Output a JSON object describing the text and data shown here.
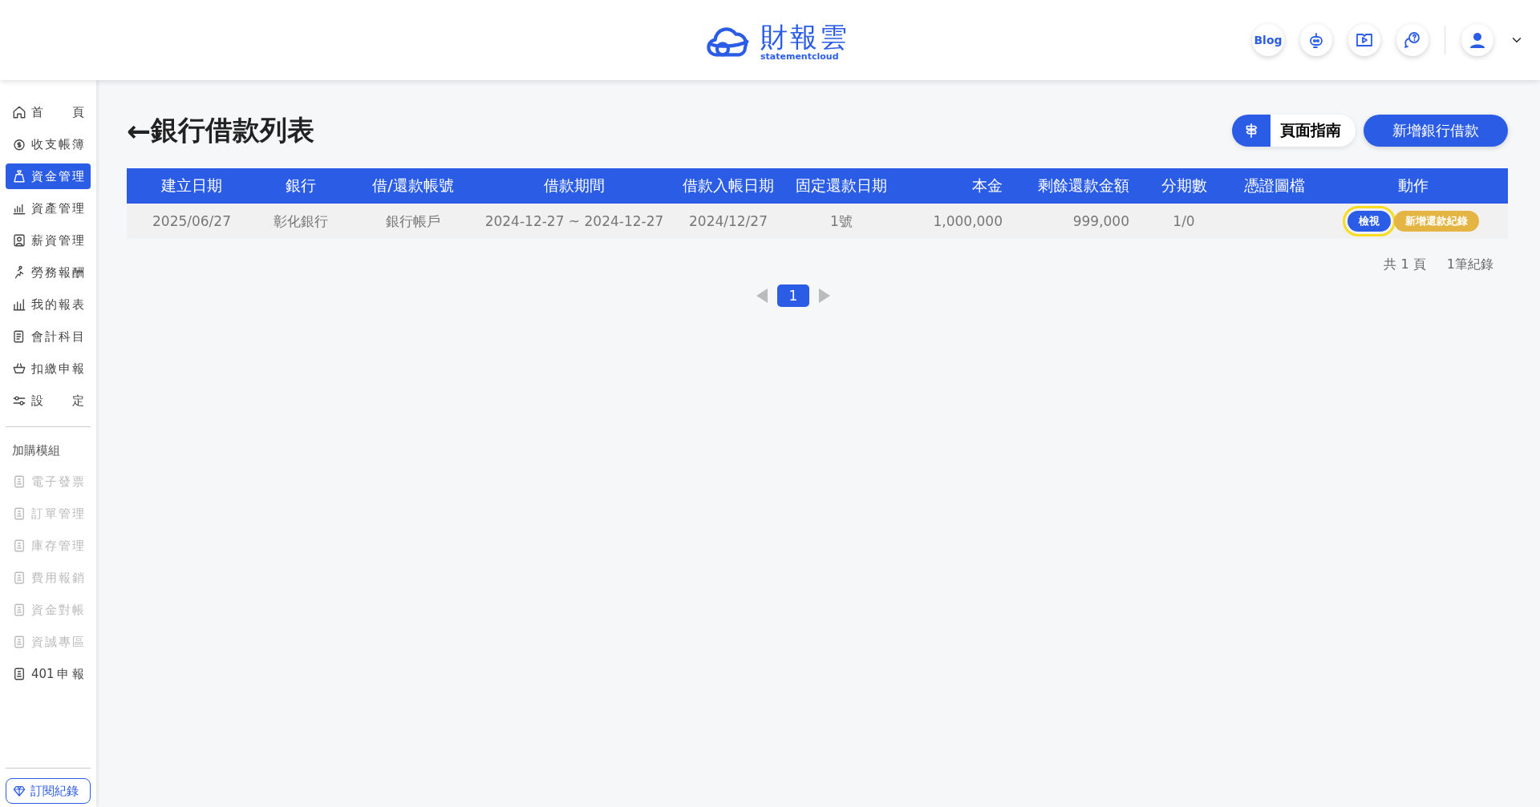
{
  "header": {
    "logo_name": "財報雲",
    "logo_subtitle": "statementcloud",
    "blog_label": "Blog"
  },
  "sidebar": {
    "items": [
      {
        "label": "首 頁",
        "selected": false
      },
      {
        "label": "收支帳簿",
        "selected": false
      },
      {
        "label": "資金管理",
        "selected": true
      },
      {
        "label": "資產管理",
        "selected": false
      },
      {
        "label": "薪資管理",
        "selected": false
      },
      {
        "label": "勞務報酬",
        "selected": false
      },
      {
        "label": "我的報表",
        "selected": false
      },
      {
        "label": "會計科目",
        "selected": false
      },
      {
        "label": "扣繳申報",
        "selected": false
      },
      {
        "label": "設 定",
        "selected": false
      }
    ],
    "addons_title": "加購模組",
    "addons": [
      {
        "label": "電子發票",
        "disabled": true
      },
      {
        "label": "訂單管理",
        "disabled": true
      },
      {
        "label": "庫存管理",
        "disabled": true
      },
      {
        "label": "費用報銷",
        "disabled": true
      },
      {
        "label": "資金對帳",
        "disabled": true
      },
      {
        "label": "資誠專區",
        "disabled": true
      },
      {
        "label": "401申報",
        "disabled": false
      }
    ],
    "subscription_button": "訂閱紀錄"
  },
  "page": {
    "back_arrow": "←",
    "title": "銀行借款列表",
    "guide_button": "頁面指南",
    "add_button": "新增銀行借款"
  },
  "table": {
    "columns": [
      "建立日期",
      "銀行",
      "借/還款帳號",
      "借款期間",
      "借款入帳日期",
      "固定還款日期",
      "本金",
      "剩餘還款金額",
      "分期數",
      "憑證圖檔",
      "動作"
    ],
    "rows": [
      {
        "cells": [
          "2025/06/27",
          "彰化銀行",
          "銀行帳戶",
          "2024-12-27 ~ 2024-12-27",
          "2024/12/27",
          "1號",
          "1,000,000",
          "999,000",
          "1/0"
        ],
        "actions": [
          {
            "label": "檢視",
            "kind": "primary",
            "focused": true
          },
          {
            "label": "新增還款紀錄",
            "kind": "warning",
            "focused": false
          }
        ]
      }
    ]
  },
  "summary": {
    "pages": "共 1 頁",
    "records": "1筆紀錄"
  },
  "pagination": {
    "pages": [
      {
        "label": "1",
        "selected": true
      }
    ]
  }
}
